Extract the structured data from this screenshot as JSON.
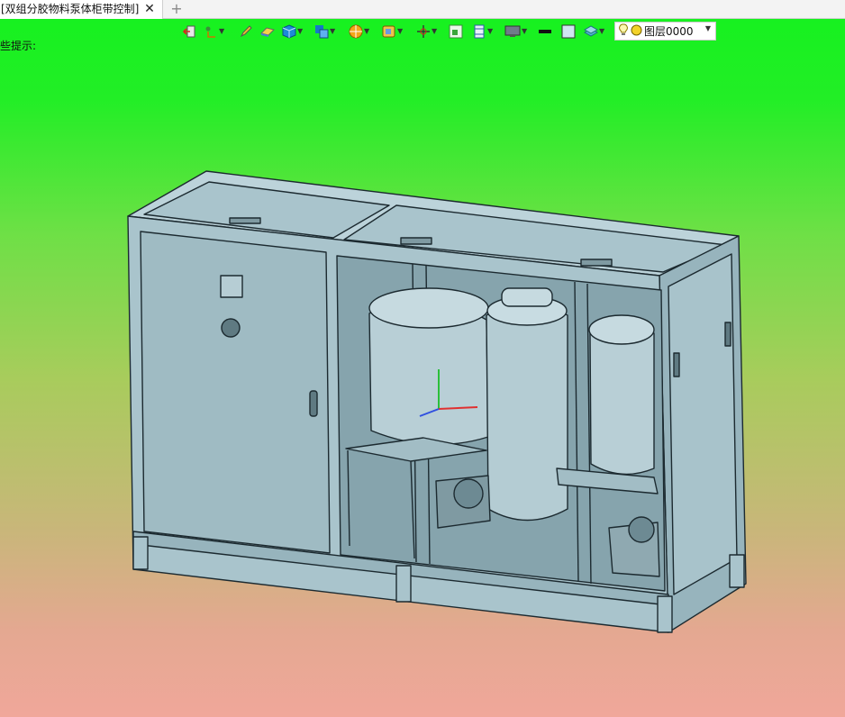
{
  "tab": {
    "title": "[双组分胶物料泵体柜带控制]",
    "close_glyph": "✕",
    "add_glyph": "+"
  },
  "hint": {
    "text": "些提示:"
  },
  "layer_select": {
    "value": "图层0000"
  },
  "toolbar": {
    "icons": [
      "exit-sketch-icon",
      "point-icon",
      "pencil-icon",
      "eraser-icon",
      "cube-icon",
      "view-cube-icon",
      "render-mode-icon",
      "section-icon",
      "axes-icon",
      "fit-view-icon",
      "pan-icon",
      "display-icon",
      "color-bar-icon",
      "background-color-icon",
      "layer-icon"
    ]
  },
  "colors": {
    "model_fill": "#a9c4cc",
    "model_stroke": "#1c2a30",
    "background_top": "#14f21e",
    "background_bottom": "#f0a79a"
  }
}
